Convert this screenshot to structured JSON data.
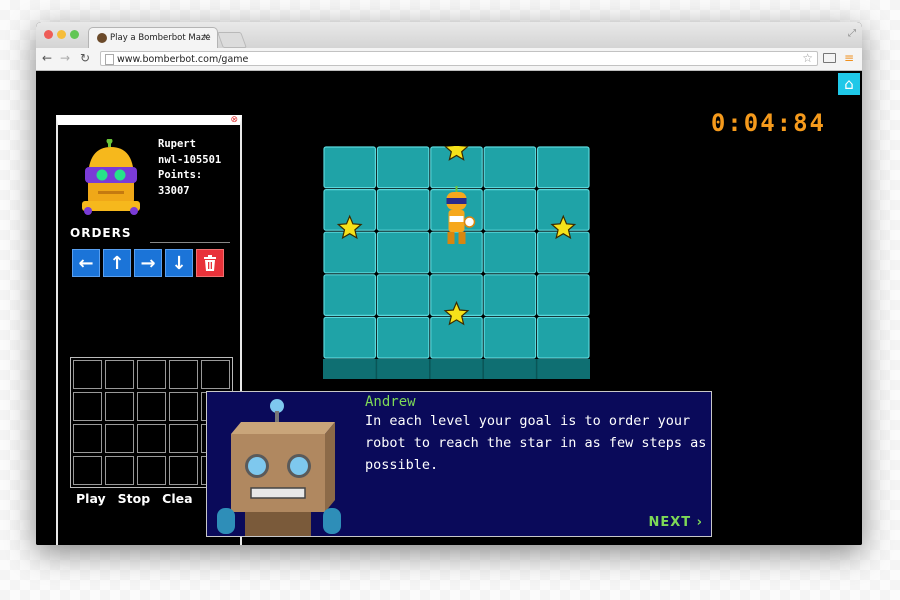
{
  "browser": {
    "tab_title": "Play a Bomberbot Maze",
    "tab_close": "×",
    "url": "www.bomberbot.com/game",
    "back": "←",
    "forward": "→",
    "reload": "↻",
    "bookmark": "☆",
    "menu": "≡",
    "fullscreen": "⤢"
  },
  "game": {
    "home_icon": "⌂",
    "timer": "0:04:84",
    "player": {
      "name": "Rupert",
      "id": "nwl-105501",
      "points": "Points: 33007"
    },
    "orders_label": "ORDERS",
    "commands": [
      {
        "label": "←",
        "name": "left-arrow"
      },
      {
        "label": "↑",
        "name": "up-arrow"
      },
      {
        "label": "→",
        "name": "right-arrow"
      },
      {
        "label": "↓",
        "name": "down-arrow"
      }
    ],
    "buttons": {
      "play": "Play",
      "stop": "Stop",
      "clear": "Clea"
    },
    "board": {
      "cols": 5,
      "rows": 5
    },
    "dialog": {
      "speaker": "Andrew",
      "message": "In each level your goal is to order your robot to reach the star in as few steps as possible.",
      "next": "NEXT ›"
    }
  },
  "colors": {
    "tile": "#1fa3a7",
    "tile_border": "#5ad8dc",
    "timer": "#f59a1c",
    "command": "#1b74d8",
    "delete": "#e8323a",
    "dialog_bg": "#0a0a5a",
    "speaker": "#7ed957"
  }
}
